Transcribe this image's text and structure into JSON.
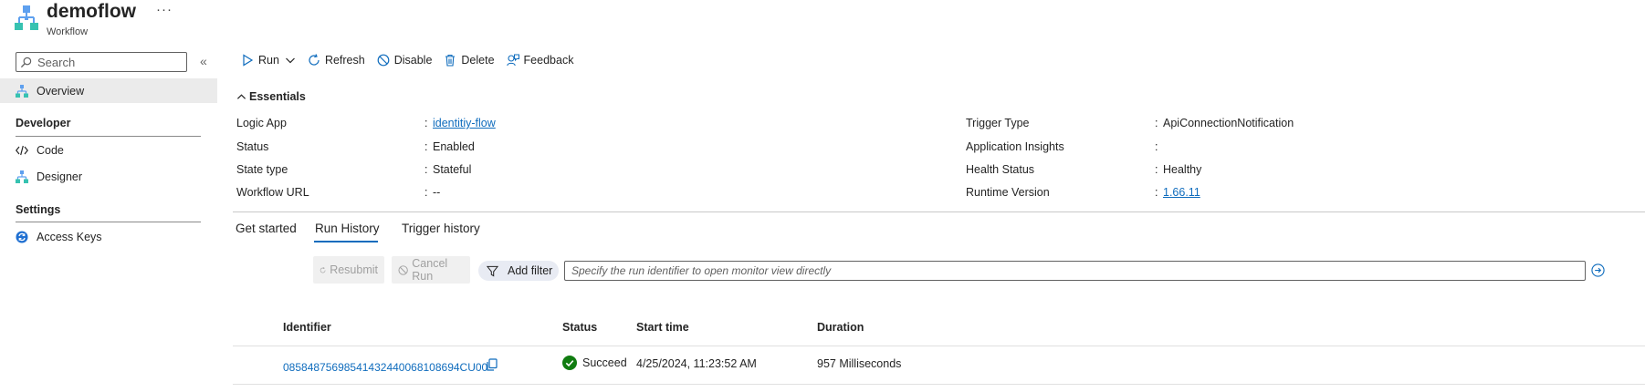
{
  "header": {
    "title": "demoflow",
    "subtitle": "Workflow",
    "more": "···"
  },
  "sidebar": {
    "search_placeholder": "Search",
    "collapse": "«",
    "overview": "Overview",
    "developer_heading": "Developer",
    "code": "Code",
    "designer": "Designer",
    "settings_heading": "Settings",
    "access_keys": "Access Keys"
  },
  "toolbar": {
    "run": "Run",
    "refresh": "Refresh",
    "disable": "Disable",
    "delete": "Delete",
    "feedback": "Feedback"
  },
  "essentials": {
    "heading": "Essentials",
    "left": [
      {
        "label": "Logic App",
        "value": "identitiy-flow",
        "link": true
      },
      {
        "label": "Status",
        "value": "Enabled",
        "link": false
      },
      {
        "label": "State type",
        "value": "Stateful",
        "link": false
      },
      {
        "label": "Workflow URL",
        "value": "--",
        "link": false
      }
    ],
    "right": [
      {
        "label": "Trigger Type",
        "value": "ApiConnectionNotification",
        "link": false
      },
      {
        "label": "Application Insights",
        "value": "",
        "link": false
      },
      {
        "label": "Health Status",
        "value": "Healthy",
        "link": false
      },
      {
        "label": "Runtime Version",
        "value": "1.66.11",
        "link": true
      }
    ]
  },
  "tabs": {
    "get_started": "Get started",
    "run_history": "Run History",
    "trigger_history": "Trigger history",
    "active": "Run History"
  },
  "run_history": {
    "resubmit": "Resubmit",
    "cancel_run": "Cancel Run",
    "add_filter": "Add filter",
    "run_id_placeholder": "Specify the run identifier to open monitor view directly",
    "columns": {
      "identifier": "Identifier",
      "status": "Status",
      "start_time": "Start time",
      "duration": "Duration"
    },
    "rows": [
      {
        "identifier": "08584875698541432440068108694CU00",
        "status": "Succeeded",
        "start_time": "4/25/2024, 11:23:52 AM",
        "duration": "957 Milliseconds"
      }
    ]
  },
  "colors": {
    "accent": "#0f6cbd",
    "success": "#107c10"
  }
}
